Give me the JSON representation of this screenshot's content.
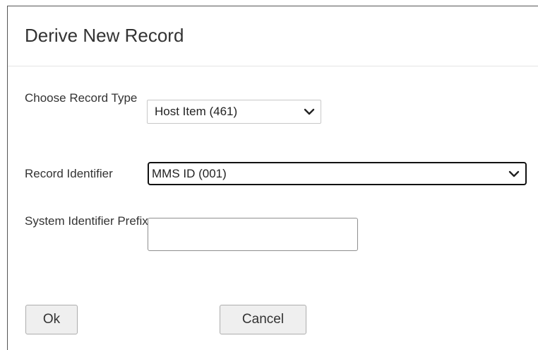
{
  "dialog": {
    "title": "Derive New Record"
  },
  "form": {
    "record_type": {
      "label": "Choose Record Type",
      "selected": "Host Item (461)",
      "icon": "chevron-down-icon"
    },
    "record_identifier": {
      "label": "Record Identifier",
      "selected": "MMS ID (001)",
      "icon": "chevron-down-icon"
    },
    "system_identifier_prefix": {
      "label": "System Identifier Prefix",
      "value": "",
      "placeholder": ""
    }
  },
  "actions": {
    "ok_label": "Ok",
    "cancel_label": "Cancel"
  }
}
